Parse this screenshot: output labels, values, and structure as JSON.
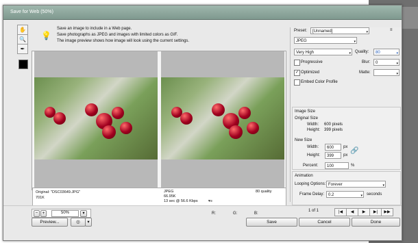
{
  "window": {
    "title": "Save for Web (50%)"
  },
  "toolbar": {
    "hand_icon": "✋",
    "zoom_icon": "🔍",
    "eyedropper_icon": "✒",
    "colors": [
      "#000000"
    ]
  },
  "instructions": {
    "line1": "Save an image to include in a Web page.",
    "line2": "Save photographs as JPEG and images with limited colors as GIF.",
    "line3": "The image preview shows how image will look using the current settings."
  },
  "preview": {
    "original_label": "Original: \"DSC03649.JPG\"",
    "original_size": "701K",
    "optimized_format": "JPEG",
    "optimized_size": "66.95K",
    "optimized_time": "13 sec @ 56.6 Kbps",
    "optimized_quality": "80 quality",
    "menu_icon": "▾≡"
  },
  "zoom": {
    "value": "50%"
  },
  "coords": {
    "r": "R:",
    "g": "G:",
    "b": "B:"
  },
  "preset": {
    "label": "Preset:",
    "value": "[Unnamed]",
    "format": "JPEG",
    "quality_level": "Very High",
    "quality_label": "Quality:",
    "quality_value": "80",
    "progressive_label": "Progressive",
    "blur_label": "Blur:",
    "blur_value": "0",
    "optimized_label": "Optimized",
    "matte_label": "Matte:",
    "embed_label": "Embed Color Profile",
    "menu_icon": "≡"
  },
  "image_size": {
    "title": "Image Size",
    "original_title": "Original Size",
    "width_label": "Width:",
    "width_value": "600 pixels",
    "height_label": "Height:",
    "height_value": "399 pixels",
    "new_title": "New Size",
    "new_width": "600",
    "new_height": "399",
    "unit": "px",
    "percent_label": "Percent:",
    "percent_value": "100",
    "percent_unit": "%"
  },
  "animation": {
    "title": "Animation",
    "looping_label": "Looping Options:",
    "looping_value": "Forever",
    "frame_delay_label": "Frame Delay:",
    "frame_delay_value": "0.2",
    "seconds": "seconds",
    "frame_count": "1 of 1"
  },
  "buttons": {
    "preview": "Preview...",
    "save": "Save",
    "cancel": "Cancel",
    "done": "Done"
  }
}
